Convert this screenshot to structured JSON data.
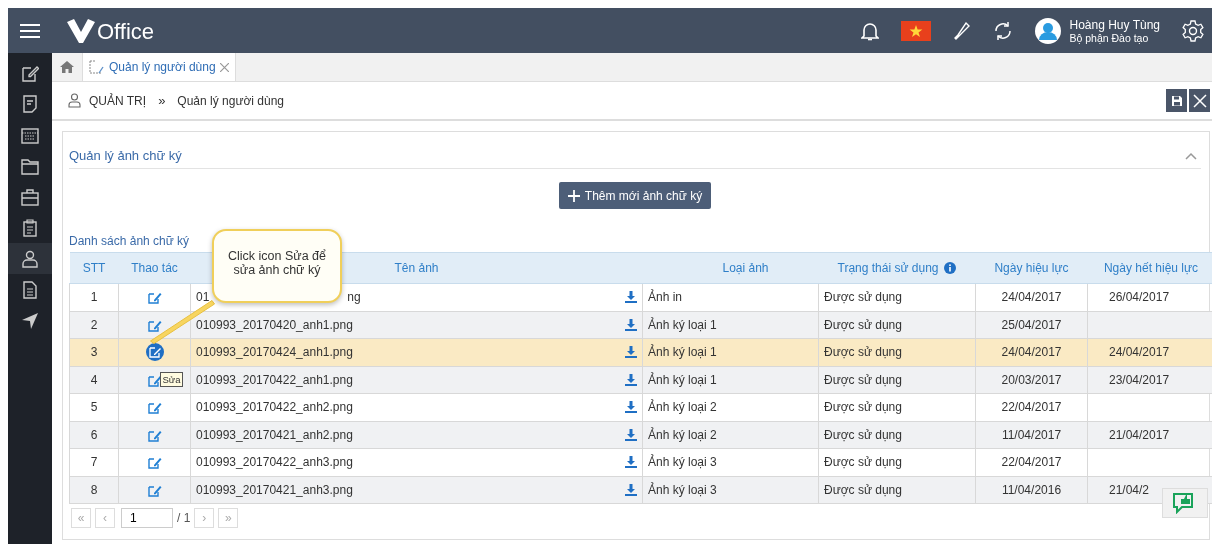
{
  "app": {
    "logo_text": "Office"
  },
  "user": {
    "name": "Hoàng Huy Tùng",
    "department": "Bộ phận Đào tạo"
  },
  "sidebar": {
    "items": [
      {
        "selected": false
      },
      {
        "selected": false
      },
      {
        "selected": false
      },
      {
        "selected": false
      },
      {
        "selected": false
      },
      {
        "selected": false
      },
      {
        "selected": true
      },
      {
        "selected": false
      },
      {
        "selected": false
      }
    ]
  },
  "tabs": [
    {
      "label": "Quản lý người dùng",
      "selected": true
    }
  ],
  "breadcrumb": {
    "items": [
      "QUẢN TRỊ",
      "Quản lý người dùng"
    ],
    "separator": "»"
  },
  "panel": {
    "title": "Quản lý ảnh chữ ký",
    "expanded": true,
    "add_button": "Thêm mới ảnh chữ ký",
    "list_title": "Danh sách ảnh chữ ký"
  },
  "table": {
    "columns": [
      "STT",
      "Thao tác",
      "Tên ảnh",
      "Loại ảnh",
      "Trạng thái sử dụng",
      "Ngày hiệu lực",
      "Ngày hết hiệu lực"
    ],
    "rows": [
      {
        "stt": "1",
        "name": "01",
        "name_tail": "ng",
        "type": "Ảnh in",
        "status": "Được sử dụng",
        "valid_from": "24/04/2017",
        "valid_to": "26/04/2017",
        "selected": false,
        "icon_active": false
      },
      {
        "stt": "2",
        "name": "010993_20170420_anh1.png",
        "type": "Ảnh ký loại 1",
        "status": "Được sử dụng",
        "valid_from": "25/04/2017",
        "valid_to": "",
        "selected": false,
        "icon_active": false
      },
      {
        "stt": "3",
        "name": "010993_20170424_anh1.png",
        "type": "Ảnh ký loại 1",
        "status": "Được sử dụng",
        "valid_from": "24/04/2017",
        "valid_to": "24/04/2017",
        "selected": true,
        "icon_active": true
      },
      {
        "stt": "4",
        "name": "010993_20170422_anh1.png",
        "type": "Ảnh ký loại 1",
        "status": "Được sử dụng",
        "valid_from": "20/03/2017",
        "valid_to": "23/04/2017",
        "selected": false,
        "icon_active": false,
        "tooltip": "Sửa"
      },
      {
        "stt": "5",
        "name": "010993_20170422_anh2.png",
        "type": "Ảnh ký loại 2",
        "status": "Được sử dụng",
        "valid_from": "22/04/2017",
        "valid_to": "",
        "selected": false,
        "icon_active": false
      },
      {
        "stt": "6",
        "name": "010993_20170421_anh2.png",
        "type": "Ảnh ký loại 2",
        "status": "Được sử dụng",
        "valid_from": "11/04/2017",
        "valid_to": "21/04/2017",
        "selected": false,
        "icon_active": false
      },
      {
        "stt": "7",
        "name": "010993_20170422_anh3.png",
        "type": "Ảnh ký loại 3",
        "status": "Được sử dụng",
        "valid_from": "22/04/2017",
        "valid_to": "",
        "selected": false,
        "icon_active": false
      },
      {
        "stt": "8",
        "name": "010993_20170421_anh3.png",
        "type": "Ảnh ký loại 3",
        "status": "Được sử dụng",
        "valid_from": "11/04/2016",
        "valid_to": "21/04/2",
        "selected": false,
        "icon_active": false
      }
    ]
  },
  "pager": {
    "first": "«",
    "prev": "‹",
    "page": "1",
    "total": "/ 1",
    "next": "›",
    "last": "»"
  },
  "callout": {
    "text": "Click icon Sửa để sửa ảnh chữ ký"
  }
}
